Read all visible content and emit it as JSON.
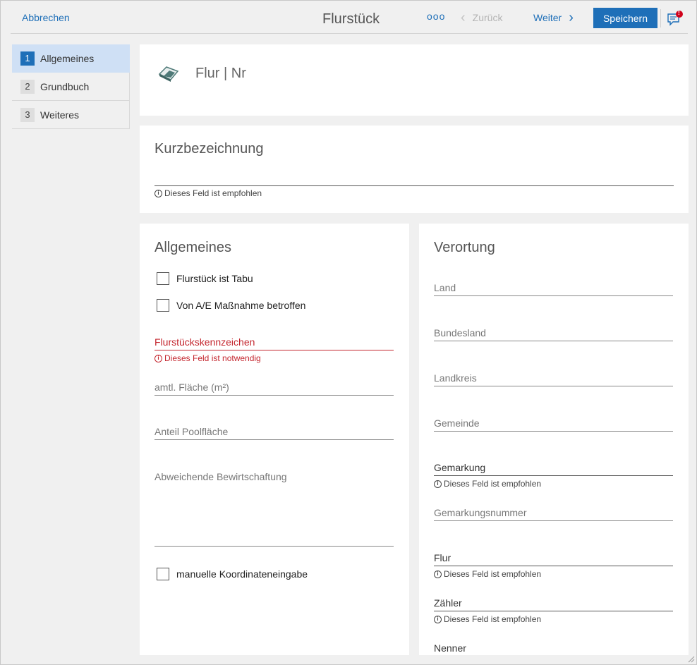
{
  "header": {
    "cancel_label": "Abbrechen",
    "title": "Flurstück",
    "more_label": "ooo",
    "back_label": "Zurück",
    "next_label": "Weiter",
    "save_label": "Speichern",
    "notification_badge": "!"
  },
  "sidebar": {
    "items": [
      {
        "num": "1",
        "label": "Allgemeines",
        "active": true
      },
      {
        "num": "2",
        "label": "Grundbuch",
        "active": false
      },
      {
        "num": "3",
        "label": "Weiteres",
        "active": false
      }
    ]
  },
  "top_card": {
    "icon": "parcel-icon",
    "title": "Flur | Nr"
  },
  "kurz_card": {
    "title": "Kurzbezeichnung",
    "hint": "Dieses Feld ist empfohlen"
  },
  "allgemeines": {
    "title": "Allgemeines",
    "checkbox_tabu": "Flurstück ist Tabu",
    "checkbox_massnahme": "Von A/E Maßnahme betroffen",
    "field_kennzeichen": "Flurstückskennzeichen",
    "hint_kennzeichen": "Dieses Feld ist notwendig",
    "field_flaeche": "amtl. Fläche (m²)",
    "field_pool": "Anteil Poolfläche",
    "field_bewirtschaftung": "Abweichende Bewirtschaftung",
    "checkbox_koordinaten": "manuelle Koordinateneingabe"
  },
  "verortung": {
    "title": "Verortung",
    "field_land": "Land",
    "field_bundesland": "Bundesland",
    "field_landkreis": "Landkreis",
    "field_gemeinde": "Gemeinde",
    "field_gemarkung": "Gemarkung",
    "hint_gemarkung": "Dieses Feld ist empfohlen",
    "field_gemarkungsnummer": "Gemarkungsnummer",
    "field_flur": "Flur",
    "hint_flur": "Dieses Feld ist empfohlen",
    "field_zaehler": "Zähler",
    "hint_zaehler": "Dieses Feld ist empfohlen",
    "field_nenner": "Nenner"
  },
  "colors": {
    "accent": "#1e6fb8",
    "error": "#c4262e",
    "sidebar_active": "#cfe0f5",
    "background": "#f0f0f0"
  }
}
